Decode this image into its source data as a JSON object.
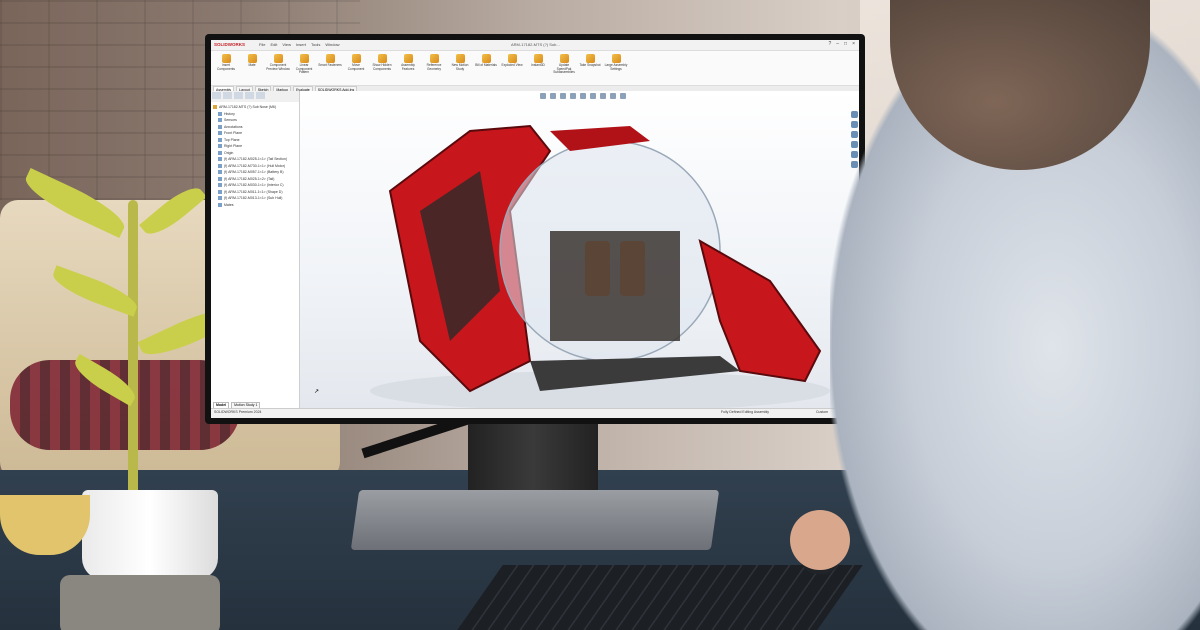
{
  "app": {
    "brand": "SOLIDWORKS",
    "document_title": "ARM-17182-MTS (?) Sub...",
    "menu": [
      "File",
      "Edit",
      "View",
      "Insert",
      "Tools",
      "Window"
    ],
    "window_controls": [
      "?",
      "–",
      "□",
      "×"
    ]
  },
  "ribbon": {
    "buttons": [
      {
        "label": "Insert Components",
        "icon": "insert-components-icon"
      },
      {
        "label": "Mate",
        "icon": "mate-icon"
      },
      {
        "label": "Component Preview Window",
        "icon": "preview-icon"
      },
      {
        "label": "Linear Component Pattern",
        "icon": "pattern-icon"
      },
      {
        "label": "Smart Fasteners",
        "icon": "fastener-icon"
      },
      {
        "label": "Move Component",
        "icon": "move-icon"
      },
      {
        "label": "Show Hidden Components",
        "icon": "show-hidden-icon"
      },
      {
        "label": "Assembly Features",
        "icon": "assembly-features-icon"
      },
      {
        "label": "Reference Geometry",
        "icon": "reference-geometry-icon"
      },
      {
        "label": "New Motion Study",
        "icon": "motion-icon"
      },
      {
        "label": "Bill of Materials",
        "icon": "bom-icon"
      },
      {
        "label": "Exploded View",
        "icon": "exploded-icon"
      },
      {
        "label": "Instant3D",
        "icon": "instant3d-icon"
      },
      {
        "label": "Update SpeedPak Subassemblies",
        "icon": "speedpak-icon"
      },
      {
        "label": "Take Snapshot",
        "icon": "snapshot-icon"
      },
      {
        "label": "Large Assembly Settings",
        "icon": "settings-icon"
      }
    ]
  },
  "command_tabs": [
    "Assembly",
    "Layout",
    "Sketch",
    "Markup",
    "Evaluate",
    "SOLIDWORKS Add-Ins"
  ],
  "feature_tree": {
    "root": "ARM-17182-MTS (?) Sub Nose (M6)",
    "items": [
      "History",
      "Sensors",
      "Annotations",
      "Front Plane",
      "Top Plane",
      "Right Plane",
      "Origin",
      "(f) ARM-17182-M025-1<1> (Tail Section)",
      "(f) ARM-17182-M730-1<1> (Hull Motor)",
      "(f) ARM-17182-M057-1<1> (Battery B)",
      "(f) ARM-17182-M025-1<2> (Tail)",
      "(f) ARM-17182-M030-1<1> (Interior C)",
      "(f) ARM-17182-M011-1<1> (Shape D)",
      "(f) ARM-17182-M013-1<1> (Sub Hull)",
      "Mates"
    ]
  },
  "model_tabs": [
    "Model",
    "Motion Study 1"
  ],
  "status_bar": {
    "left": "SOLIDWORKS Premium 2024",
    "middle": "Fully Defined  Editing Assembly",
    "right": "Custom"
  }
}
